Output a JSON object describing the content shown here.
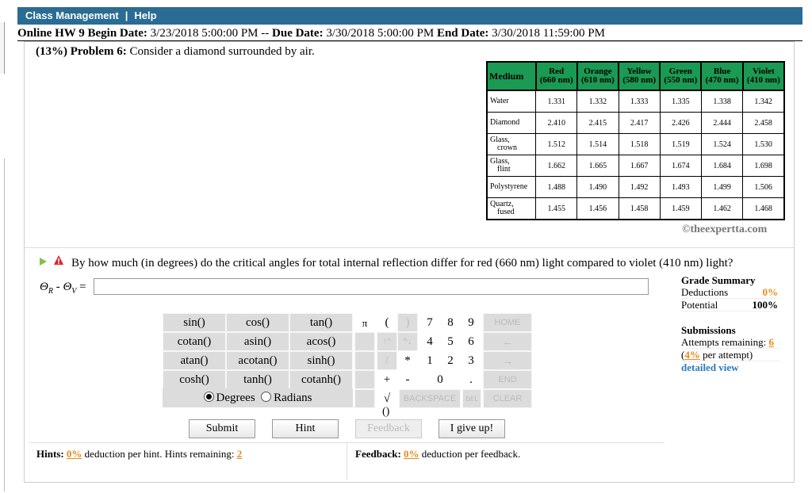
{
  "nav": {
    "item1": "Class Management",
    "separator": "|",
    "item2": "Help"
  },
  "dates": {
    "assignment": "Online HW 9",
    "begin_label": "Begin Date:",
    "begin": "3/23/2018 5:00:00 PM",
    "dash": "--",
    "due_label": "Due Date:",
    "due": "3/30/2018 5:00:00 PM",
    "end_label": "End Date:",
    "end": "3/30/2018 11:59:00 PM"
  },
  "problem": {
    "weight": "(13%)",
    "label": "Problem 6:",
    "text": "Consider a diamond surrounded by air."
  },
  "table": {
    "corner": "Medium",
    "headers": [
      [
        "Red",
        "(660 nm)"
      ],
      [
        "Orange",
        "(610 nm)"
      ],
      [
        "Yellow",
        "(580 nm)"
      ],
      [
        "Green",
        "(550 nm)"
      ],
      [
        "Blue",
        "(470 nm)"
      ],
      [
        "Violet",
        "(410 nm)"
      ]
    ],
    "rows": [
      {
        "medium": [
          "Water"
        ],
        "values": [
          "1.331",
          "1.332",
          "1.333",
          "1.335",
          "1.338",
          "1.342"
        ]
      },
      {
        "medium": [
          "Diamond"
        ],
        "values": [
          "2.410",
          "2.415",
          "2.417",
          "2.426",
          "2.444",
          "2.458"
        ]
      },
      {
        "medium": [
          "Glass,",
          "crown"
        ],
        "values": [
          "1.512",
          "1.514",
          "1.518",
          "1.519",
          "1.524",
          "1.530"
        ]
      },
      {
        "medium": [
          "Glass,",
          "flint"
        ],
        "values": [
          "1.662",
          "1.665",
          "1.667",
          "1.674",
          "1.684",
          "1.698"
        ]
      },
      {
        "medium": [
          "Polystyrene"
        ],
        "values": [
          "1.488",
          "1.490",
          "1.492",
          "1.493",
          "1.499",
          "1.506"
        ]
      },
      {
        "medium": [
          "Quartz,",
          "fused"
        ],
        "values": [
          "1.455",
          "1.456",
          "1.458",
          "1.459",
          "1.462",
          "1.468"
        ]
      }
    ],
    "credit": "©theexpertta.com"
  },
  "question": {
    "text": "By how much (in degrees) do the critical angles for total internal reflection differ for red (660 nm) light compared to violet (410 nm) light?",
    "label_theta1": "Θ",
    "label_sub1": "R",
    "label_minus": " - ",
    "label_theta2": "Θ",
    "label_sub2": "V",
    "label_eq": " = ",
    "input_value": ""
  },
  "keypad": {
    "functions": [
      [
        "sin()",
        "cos()",
        "tan()"
      ],
      [
        "cotan()",
        "asin()",
        "acos()"
      ],
      [
        "atan()",
        "acotan()",
        "sinh()"
      ],
      [
        "cosh()",
        "tanh()",
        "cotanh()"
      ]
    ],
    "pi": "π",
    "open_paren": "(",
    "close_paren": ")",
    "up_arrows": "↑^",
    "down_arrows": "^↓",
    "divide": "/",
    "multiply": "*",
    "plus": "+",
    "minus": "-",
    "sqrt": "√",
    "digits_row1": [
      "7",
      "8",
      "9"
    ],
    "digits_row2": [
      "4",
      "5",
      "6"
    ],
    "digits_row3": [
      "1",
      "2",
      "3"
    ],
    "zero": "0",
    "dot": ".",
    "home": "HOME",
    "left_arrow": "←",
    "right_arrow": "→",
    "end": "END",
    "backspace": "BACKSPACE",
    "del": "DEL",
    "clear": "CLEAR",
    "degrees": "Degrees",
    "radians": "Radians",
    "bottom_paren": "()"
  },
  "actions": {
    "submit": "Submit",
    "hint": "Hint",
    "feedback": "Feedback",
    "give_up": "I give up!"
  },
  "hints": {
    "label": "Hints:",
    "pct": "0%",
    "text": "deduction per hint. Hints remaining:",
    "remaining": "2"
  },
  "feedback_info": {
    "label": "Feedback:",
    "pct": "0%",
    "text": "deduction per feedback."
  },
  "grade": {
    "title": "Grade Summary",
    "deductions_label": "Deductions",
    "deductions": "0%",
    "potential_label": "Potential",
    "potential": "100%"
  },
  "submissions": {
    "title": "Submissions",
    "attempts_label": "Attempts remaining:",
    "attempts": "6",
    "per_attempt_pct": "4%",
    "per_attempt_text": "per attempt)",
    "open_paren": "(",
    "detail": "detailed view"
  }
}
